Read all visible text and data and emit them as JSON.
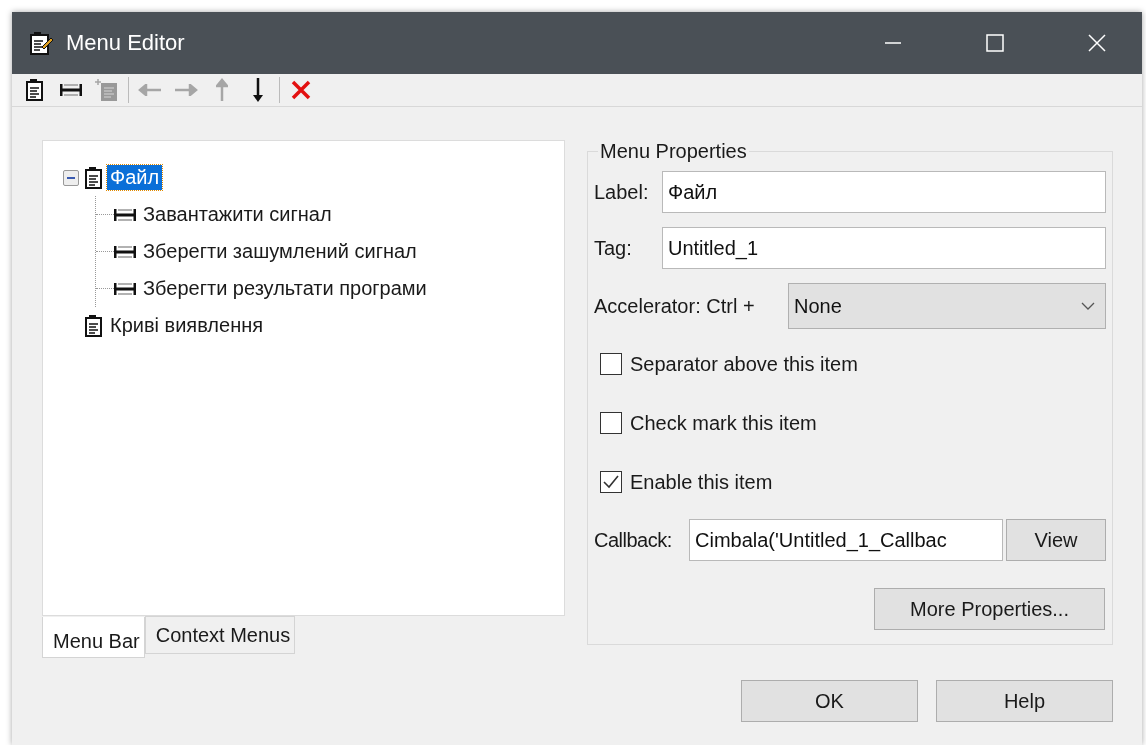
{
  "window": {
    "title": "Menu Editor"
  },
  "toolbar": [
    {
      "kind": "new-menu",
      "disabled": false
    },
    {
      "kind": "new-item",
      "disabled": false
    },
    {
      "kind": "new-child",
      "disabled": true
    },
    {
      "kind": "separator"
    },
    {
      "kind": "left",
      "disabled": true
    },
    {
      "kind": "right",
      "disabled": true
    },
    {
      "kind": "up",
      "disabled": true
    },
    {
      "kind": "down",
      "disabled": false
    },
    {
      "kind": "separator"
    },
    {
      "kind": "delete",
      "disabled": false
    }
  ],
  "tree": [
    {
      "label": "Файл",
      "kind": "menu",
      "selected": true,
      "expanded": true,
      "children": [
        {
          "label": "Завантажити сигнал",
          "kind": "item",
          "selected": false
        },
        {
          "label": "Зберегти зашумлений сигнал",
          "kind": "item",
          "selected": false
        },
        {
          "label": "Зберегти результати програми",
          "kind": "item",
          "selected": false
        }
      ]
    },
    {
      "label": "Криві виявлення",
      "kind": "menu",
      "selected": false
    }
  ],
  "tabs": [
    {
      "label": "Menu Bar",
      "selected": true
    },
    {
      "label": "Context Menus",
      "selected": false
    }
  ],
  "properties": {
    "title": "Menu Properties",
    "label_field": {
      "label": "Label:",
      "value": "Файл"
    },
    "tag_field": {
      "label": "Tag:",
      "value": "Untitled_1"
    },
    "accelerator": {
      "label": "Accelerator: Ctrl +",
      "value": "None"
    },
    "checkboxes": [
      {
        "label": "Separator above this item",
        "checked": false
      },
      {
        "label": "Check mark this item",
        "checked": false
      },
      {
        "label": "Enable this item",
        "checked": true
      }
    ],
    "callback": {
      "label": "Callback:",
      "value": "Cimbala('Untitled_1_Callbac",
      "button": "View"
    },
    "more_button": "More Properties..."
  },
  "buttons": [
    "OK",
    "Help"
  ]
}
